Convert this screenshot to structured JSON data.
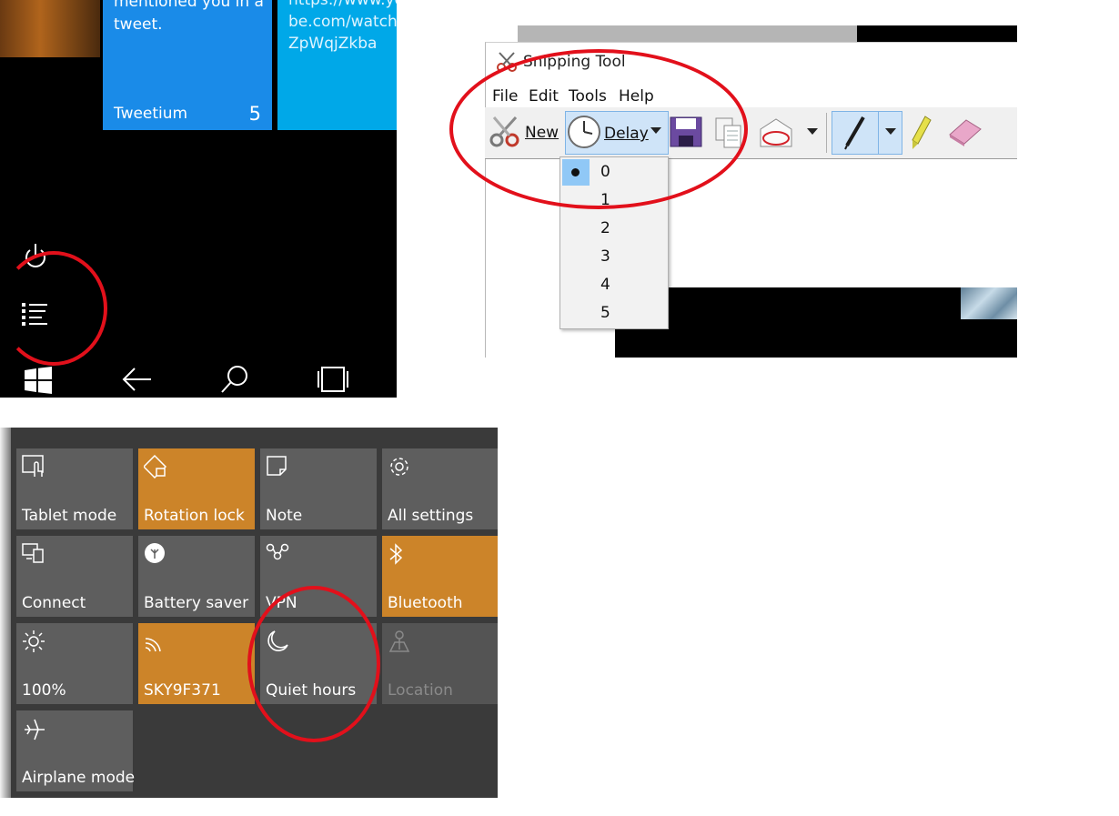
{
  "phone": {
    "tweet_tile": {
      "message": "mentioned you in a tweet.",
      "app_name": "Tweetium",
      "count": "5"
    },
    "link_tile": {
      "url": "https://www.youtube.com/watch?v=JZpWqjZkba"
    },
    "icons": [
      "power-icon",
      "all-apps-list-icon",
      "windows-start-icon",
      "back-arrow-icon",
      "search-icon",
      "task-view-icon"
    ]
  },
  "snipping_tool": {
    "title": "Snipping Tool",
    "menu": [
      "File",
      "Edit",
      "Tools",
      "Help"
    ],
    "new_label": "New",
    "delay_label": "Delay",
    "delay_options": [
      "0",
      "1",
      "2",
      "3",
      "4",
      "5"
    ],
    "selected_delay": "0"
  },
  "action_center": {
    "tiles": [
      {
        "label": "Tablet mode",
        "icon": "tablet-mode-icon",
        "state": "off"
      },
      {
        "label": "Rotation lock",
        "icon": "rotation-lock-icon",
        "state": "on"
      },
      {
        "label": "Note",
        "icon": "note-icon",
        "state": "off"
      },
      {
        "label": "All settings",
        "icon": "gear-icon",
        "state": "off"
      },
      {
        "label": "Connect",
        "icon": "connect-icon",
        "state": "off"
      },
      {
        "label": "Battery saver",
        "icon": "battery-saver-icon",
        "state": "off"
      },
      {
        "label": "VPN",
        "icon": "vpn-icon",
        "state": "off"
      },
      {
        "label": "Bluetooth",
        "icon": "bluetooth-icon",
        "state": "on"
      },
      {
        "label": "100%",
        "icon": "brightness-icon",
        "state": "off"
      },
      {
        "label": "SKY9F371",
        "icon": "wifi-icon",
        "state": "on"
      },
      {
        "label": "Quiet hours",
        "icon": "moon-icon",
        "state": "off"
      },
      {
        "label": "Location",
        "icon": "location-icon",
        "state": "disabled"
      },
      {
        "label": "Airplane mode",
        "icon": "airplane-icon",
        "state": "off"
      }
    ]
  },
  "colors": {
    "highlight_ring": "#e2101b",
    "tile_on": "#cc8429",
    "tile_off": "#5e5e5e",
    "tweet_tile": "#1a8be8"
  }
}
